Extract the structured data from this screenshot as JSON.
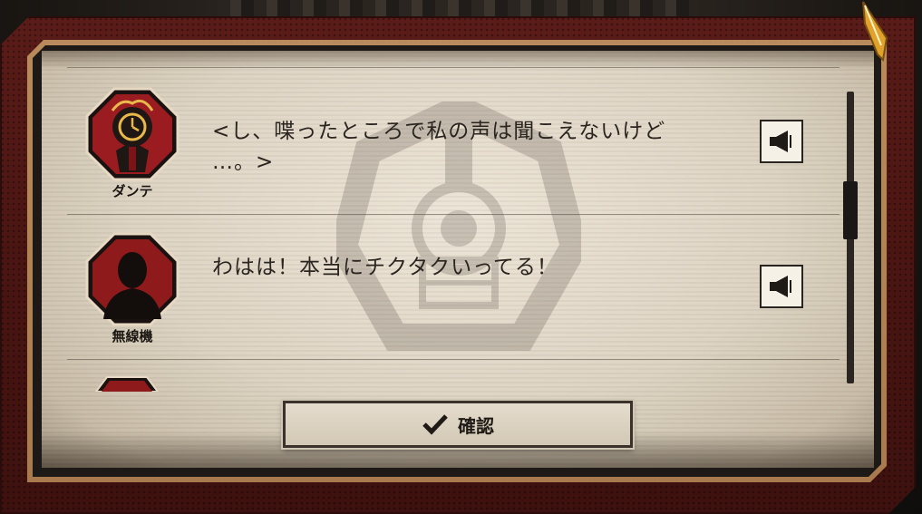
{
  "dialog_log": {
    "entries": [
      {
        "speaker": "ダンテ",
        "text_line1": "<し、喋ったところで私の声は聞こえないけど",
        "text_line2": "…。>",
        "avatar_icon": "clock-head-portrait-icon",
        "voice_icon": "speaker-icon"
      },
      {
        "speaker": "無線機",
        "text_line1": "わはは！本当にチクタクいってる！",
        "text_line2": "",
        "avatar_icon": "silhouette-portrait-icon",
        "voice_icon": "speaker-icon"
      }
    ],
    "confirm_label": "確認",
    "confirm_icon": "checkmark-icon"
  },
  "colors": {
    "frame_red": "#4a1512",
    "frame_tan": "#b98a5b",
    "parchment": "#e4dccd",
    "avatar_red": "#8f1a1c",
    "accent_gold": "#e0a22a"
  }
}
